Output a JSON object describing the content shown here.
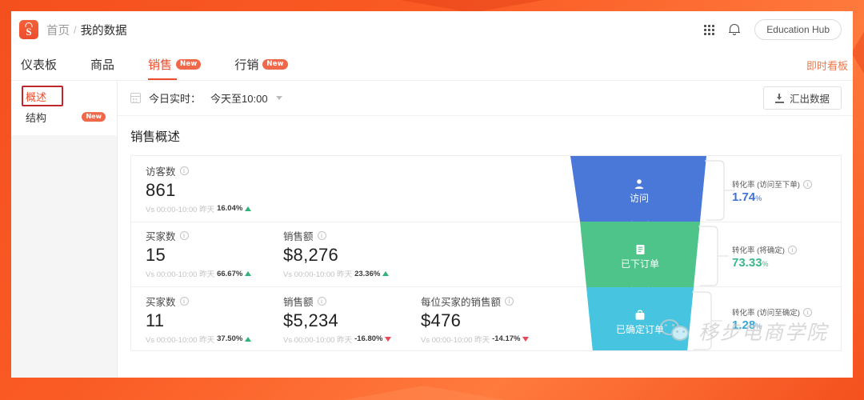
{
  "header": {
    "logo_name": "shopee-logo",
    "breadcrumb_home": "首页",
    "breadcrumb_sep": "/",
    "breadcrumb_current": "我的数据",
    "grid_icon": "apps-grid-icon",
    "bell_icon": "notification-bell-icon",
    "education_hub": "Education Hub"
  },
  "tabs": {
    "items": [
      {
        "label": "仪表板",
        "badge": "",
        "active": false
      },
      {
        "label": "商品",
        "badge": "",
        "active": false
      },
      {
        "label": "销售",
        "badge": "New",
        "active": true
      },
      {
        "label": "行销",
        "badge": "New",
        "active": false
      }
    ],
    "live_board": "即时看板"
  },
  "sidebar": {
    "items": [
      {
        "label": "概述",
        "badge": "",
        "active": true
      },
      {
        "label": "结构",
        "badge": "New",
        "active": false
      }
    ]
  },
  "toolbar": {
    "calendar_icon": "calendar-icon",
    "date_label": "今日实时：",
    "date_value": "今天至10:00",
    "export_icon": "download-icon",
    "export_label": "汇出数据"
  },
  "panel": {
    "title": "销售概述"
  },
  "chart_data": {
    "type": "funnel",
    "title": "销售概述",
    "stages": [
      {
        "label": "访问",
        "icon": "visitor-person-icon",
        "color": "#4a78d8",
        "value": 861
      },
      {
        "label": "已下订单",
        "icon": "order-document-icon",
        "color": "#4fc48a",
        "value": 15
      },
      {
        "label": "已确定订单",
        "icon": "confirmed-bag-icon",
        "color": "#46c4e0",
        "value": 11
      }
    ],
    "conversions": [
      {
        "label": "转化率 (访问至下单)",
        "value": "1.74",
        "unit": "%",
        "color": "#3f72d6"
      },
      {
        "label": "转化率 (将确定)",
        "value": "73.33",
        "unit": "%",
        "color": "#3cb98a"
      },
      {
        "label": "转化率 (访问至确定)",
        "value": "1.28",
        "unit": "%",
        "color": "#3ba7d8"
      }
    ],
    "metric_rows": [
      {
        "metrics": [
          {
            "label": "访客数",
            "value": "861",
            "vs": "Vs 00:00-10:00 昨天",
            "pct": "16.04%",
            "dir": "up"
          }
        ]
      },
      {
        "metrics": [
          {
            "label": "买家数",
            "value": "15",
            "vs": "Vs 00:00-10:00 昨天",
            "pct": "66.67%",
            "dir": "up"
          },
          {
            "label": "销售额",
            "value": "$8,276",
            "vs": "Vs 00:00-10:00 昨天",
            "pct": "23.36%",
            "dir": "up"
          }
        ]
      },
      {
        "metrics": [
          {
            "label": "买家数",
            "value": "11",
            "vs": "Vs 00:00-10:00 昨天",
            "pct": "37.50%",
            "dir": "up"
          },
          {
            "label": "销售额",
            "value": "$5,234",
            "vs": "Vs 00:00-10:00 昨天",
            "pct": "-16.80%",
            "dir": "down"
          },
          {
            "label": "每位买家的销售额",
            "value": "$476",
            "vs": "Vs 00:00-10:00 昨天",
            "pct": "-14.17%",
            "dir": "down"
          }
        ]
      }
    ]
  },
  "watermark": {
    "text": "移步电商学院",
    "icon": "wechat-logo"
  }
}
